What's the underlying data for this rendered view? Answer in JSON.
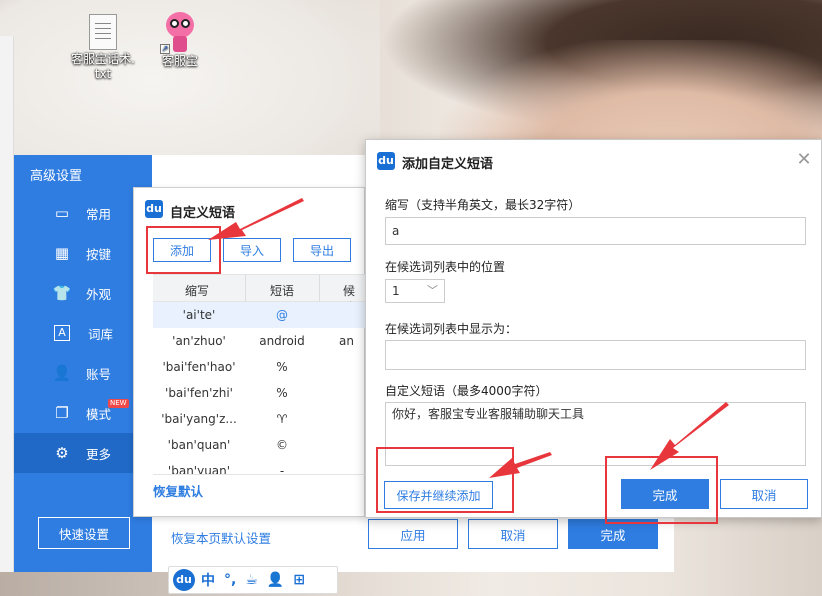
{
  "desktop": {
    "icons": [
      {
        "name": "document",
        "label_line1": "客服宝话术.",
        "label_line2": "txt"
      },
      {
        "name": "app",
        "label": "客服宝"
      }
    ]
  },
  "settings": {
    "title": "高级设置",
    "nav": [
      {
        "icon": "monitor-icon",
        "glyph": "▭",
        "label": "常用"
      },
      {
        "icon": "keyboard-icon",
        "glyph": "▦",
        "label": "按键"
      },
      {
        "icon": "shirt-icon",
        "glyph": "👕",
        "label": "外观"
      },
      {
        "icon": "dictionary-icon",
        "glyph": "A",
        "label": "词库"
      },
      {
        "icon": "user-icon",
        "glyph": "👤",
        "label": "账号"
      },
      {
        "icon": "mode-icon",
        "glyph": "❐",
        "label": "模式",
        "badge": "NEW"
      },
      {
        "icon": "gear-icon",
        "glyph": "⚙",
        "label": "更多"
      }
    ],
    "quick_setup": "快速设置",
    "restore_page": "恢复本页默认设置",
    "apply": "应用",
    "cancel": "取消",
    "done": "完成"
  },
  "phrase_dialog": {
    "title": "自定义短语",
    "add": "添加",
    "import": "导入",
    "export": "导出",
    "columns": [
      "缩写",
      "短语",
      "候选"
    ],
    "rows": [
      {
        "abbr": "'ai'te'",
        "phrase": "@",
        "extra": ""
      },
      {
        "abbr": "'an'zhuo'",
        "phrase": "android",
        "extra": "an"
      },
      {
        "abbr": "'bai'fen'hao'",
        "phrase": "%",
        "extra": ""
      },
      {
        "abbr": "'bai'fen'zhi'",
        "phrase": "%",
        "extra": ""
      },
      {
        "abbr": "'bai'yang'z...",
        "phrase": "♈",
        "extra": ""
      },
      {
        "abbr": "'ban'quan'",
        "phrase": "©",
        "extra": ""
      },
      {
        "abbr": "'ban'yuan'",
        "phrase": "-",
        "extra": ""
      }
    ],
    "restore_default": "恢复默认"
  },
  "add_dialog": {
    "title": "添加自定义短语",
    "abbr_label": "缩写（支持半角英文，最长32字符）",
    "abbr_value": "a",
    "position_label": "在候选词列表中的位置",
    "position_value": "1",
    "display_label": "在候选词列表中显示为：",
    "display_value": "",
    "phrase_label": "自定义短语（最多4000字符）",
    "phrase_value": "你好，客服宝专业客服辅助聊天工具",
    "save_continue": "保存并继续添加",
    "done": "完成",
    "cancel": "取消"
  },
  "ime_bar": {
    "logo": "du",
    "items": [
      "中",
      "°,",
      "☕",
      "👤",
      "⊞"
    ]
  },
  "colors": {
    "accent": "#2f7de1",
    "annotation": "#e8363d"
  }
}
